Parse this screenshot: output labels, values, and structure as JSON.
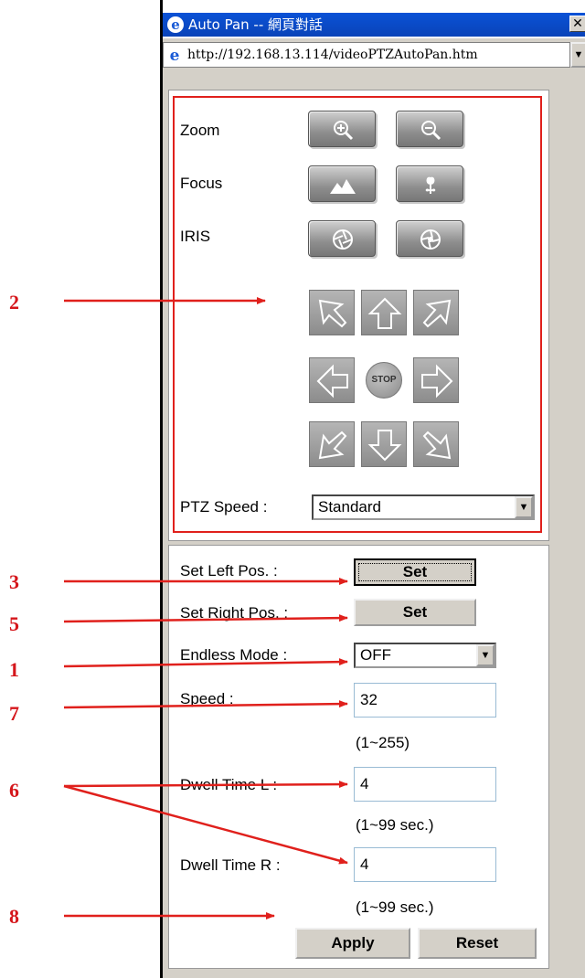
{
  "window": {
    "title": "Auto Pan -- 網頁對話",
    "close_glyph": "✕",
    "address": "http://192.168.13.114/videoPTZAutoPan.htm",
    "address_dropdown_glyph": "▼"
  },
  "ptz": {
    "zoom_label": "Zoom",
    "focus_label": "Focus",
    "iris_label": "IRIS",
    "stop_label": "STOP",
    "speed_label": "PTZ Speed :",
    "speed_value": "Standard",
    "select_arrow": "▼",
    "icons": {
      "zoom_in": "zoom-in-icon",
      "zoom_out": "zoom-out-icon",
      "focus_far": "mountain-icon",
      "focus_near": "flower-icon",
      "iris_close": "iris-close-icon",
      "iris_open": "iris-open-icon"
    }
  },
  "autopan": {
    "set_left_label": "Set Left Pos. :",
    "set_left_button": "Set",
    "set_right_label": "Set Right Pos. :",
    "set_right_button": "Set",
    "endless_label": "Endless Mode :",
    "endless_value": "OFF",
    "speed_label": "Speed :",
    "speed_value": "32",
    "speed_hint": "(1~255)",
    "dwell_l_label": "Dwell Time L :",
    "dwell_l_value": "4",
    "dwell_l_hint": "(1~99 sec.)",
    "dwell_r_label": "Dwell Time R :",
    "dwell_r_value": "4",
    "dwell_r_hint": "(1~99 sec.)",
    "apply_button": "Apply",
    "reset_button": "Reset"
  },
  "callouts": [
    "2",
    "3",
    "5",
    "1",
    "7",
    "6",
    "8"
  ],
  "colors": {
    "annotation_red": "#e0201c",
    "titlebar_blue": "#0a4bc8",
    "dialog_gray": "#d4d0c8"
  }
}
